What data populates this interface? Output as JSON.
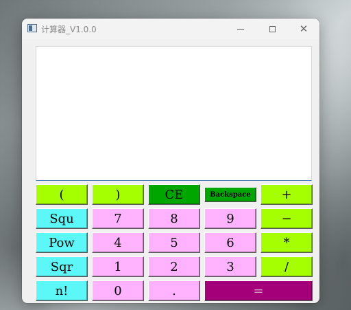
{
  "window": {
    "title": "计算器_V1.0.0",
    "controls": {
      "minimize": "minimize",
      "maximize": "maximize",
      "close": "close"
    }
  },
  "display": {
    "value": ""
  },
  "keys": {
    "lparen": "(",
    "rparen": ")",
    "ce": "CE",
    "backspace": "Backspace",
    "plus": "+",
    "squ": "Squ",
    "seven": "7",
    "eight": "8",
    "nine": "9",
    "minus": "−",
    "pow": "Pow",
    "four": "4",
    "five": "5",
    "six": "6",
    "multiply": "*",
    "sqr": "Sqr",
    "one": "1",
    "two": "2",
    "three": "3",
    "divide": "/",
    "factorial": "n!",
    "zero": "0",
    "dot": ".",
    "equals": "="
  },
  "colors": {
    "lime": "#a6ff00",
    "cyan": "#5cf8f7",
    "pink": "#ffb3fe",
    "green": "#00a600",
    "purple": "#a4007a"
  }
}
